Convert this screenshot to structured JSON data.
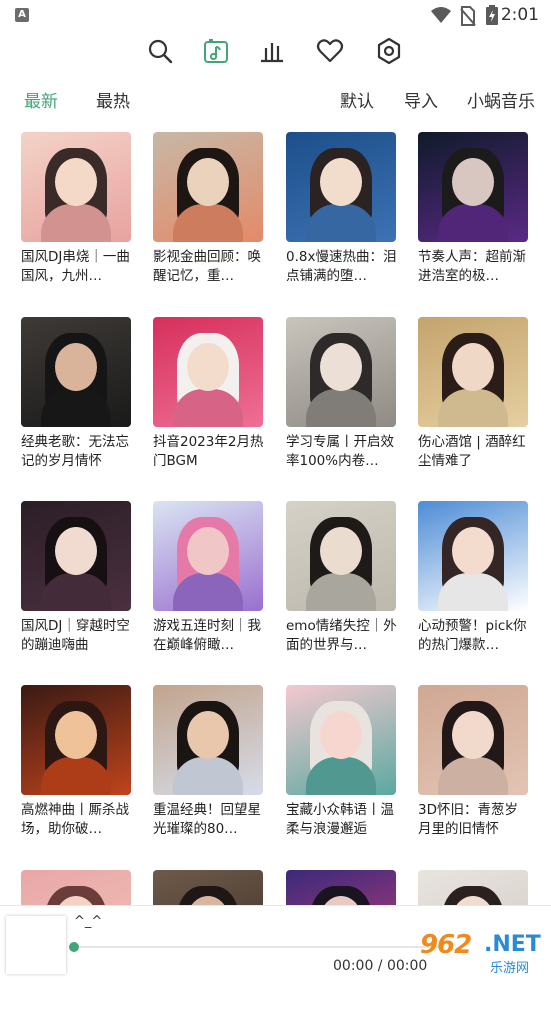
{
  "status": {
    "badge": "A",
    "time": "2:01"
  },
  "toolbar": {
    "icons": [
      "search-icon",
      "music-note-icon",
      "bar-chart-icon",
      "heart-icon",
      "settings-hexagon-icon"
    ],
    "accent": "#41a577"
  },
  "tabs": {
    "latest": "最新",
    "hottest": "最热",
    "default": "默认",
    "import": "导入",
    "source": "小蜗音乐"
  },
  "cards": [
    {
      "title": "国风DJ串烧｜一曲国风，九州…",
      "colors": [
        "#f3d3c6",
        "#e8a2a0",
        "#3a2a28",
        "#f5d9c8"
      ]
    },
    {
      "title": "影视金曲回顾：唤醒记忆，重…",
      "colors": [
        "#c7b8a6",
        "#e48a68",
        "#1e1612",
        "#ead2bd"
      ]
    },
    {
      "title": "0.8x慢速热曲：泪点铺满的堕…",
      "colors": [
        "#1c4f8a",
        "#3d72b4",
        "#2b2322",
        "#f2dccb"
      ]
    },
    {
      "title": "节奏人声：超前渐进浩室的极…",
      "colors": [
        "#0f1a2a",
        "#5a2a86",
        "#1b1b1b",
        "#d7c7c0"
      ]
    },
    {
      "title": "经典老歌：无法忘记的岁月情怀",
      "colors": [
        "#3e3a36",
        "#1a1a1a",
        "#151515",
        "#d9b39a"
      ]
    },
    {
      "title": "抖音2023年2月热门BGM",
      "colors": [
        "#d6305c",
        "#ef6f95",
        "#f3f0ef",
        "#f4dccc"
      ]
    },
    {
      "title": "学习专属丨开启效率100%内卷…",
      "colors": [
        "#c9c4bc",
        "#8e8a84",
        "#2e2a2a",
        "#ece0d6"
      ]
    },
    {
      "title": "伤心酒馆 | 酒醉红尘情难了",
      "colors": [
        "#c4a46e",
        "#e6cfa0",
        "#2a1d17",
        "#efd8c6"
      ]
    },
    {
      "title": "国风DJ｜穿越时空的蹦迪嗨曲",
      "colors": [
        "#2b1e26",
        "#4b3040",
        "#161012",
        "#f1dbd0"
      ]
    },
    {
      "title": "游戏五连时刻｜我在巅峰俯瞰…",
      "colors": [
        "#d9e4f2",
        "#9a6fd0",
        "#e57aa8",
        "#f1c6c6"
      ]
    },
    {
      "title": "emo情绪失控｜外面的世界与…",
      "colors": [
        "#d5d1c7",
        "#bcb8ae",
        "#1e1a18",
        "#ebdcd0"
      ]
    },
    {
      "title": "心动预警！pick你的热门爆款…",
      "colors": [
        "#4d8cd6",
        "#ffffff",
        "#332624",
        "#f3dccd"
      ]
    },
    {
      "title": "高燃神曲丨厮杀战场，助你破…",
      "colors": [
        "#3a1a14",
        "#c0441c",
        "#2c1713",
        "#f0c29a"
      ]
    },
    {
      "title": "重温经典！回望星光璀璨的80…",
      "colors": [
        "#c2a48c",
        "#d6dcea",
        "#1a1412",
        "#e9c7ad"
      ]
    },
    {
      "title": "宝藏小众韩语丨温柔与浪漫邂逅",
      "colors": [
        "#f4c8cf",
        "#5aa9a0",
        "#e8e3df",
        "#f7d6cf"
      ]
    },
    {
      "title": "3D怀旧：青葱岁月里的旧情怀",
      "colors": [
        "#cfa893",
        "#e3c4b4",
        "#221818",
        "#f1dacb"
      ]
    },
    {
      "title": "",
      "colors": [
        "#e9a7a7",
        "#f2c6b9",
        "#6b3d3a",
        "#f3d2c3"
      ]
    },
    {
      "title": "",
      "colors": [
        "#6e5a4a",
        "#3a2e26",
        "#1f1713",
        "#d8b7a2"
      ]
    },
    {
      "title": "",
      "colors": [
        "#3b2a7a",
        "#c73d7a",
        "#1a1420",
        "#e9c9c4"
      ]
    },
    {
      "title": "",
      "colors": [
        "#e8e4e0",
        "#cfc7c0",
        "#2a2020",
        "#f0ddd0"
      ]
    }
  ],
  "player": {
    "title": "^_^",
    "time": "00:00 / 00:00",
    "progress": 0
  },
  "watermark": {
    "num": "962",
    "net": ".NET",
    "cn": "乐游网"
  }
}
